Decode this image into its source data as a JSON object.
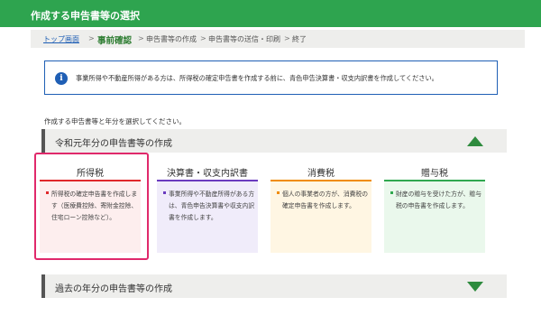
{
  "header": {
    "title": "作成する申告書等の選択"
  },
  "steps": {
    "top": "トップ画面",
    "current": "事前確認",
    "step3": "申告書等の作成",
    "step4": "申告書等の送信・印刷",
    "step5": "終了",
    "separator": ">"
  },
  "notice": {
    "icon": "i",
    "text": "事業所得や不動産所得がある方は、所得税の確定申告書を作成する前に、青色申告決算書・収支内訳書を作成してください。"
  },
  "instruction": "作成する申告書等と年分を選択してください。",
  "section_current": {
    "label": "令和元年分の申告書等の作成",
    "icon": "triangle-up"
  },
  "section_past": {
    "label": "過去の年分の申告書等の作成",
    "icon": "triangle-down"
  },
  "cards": [
    {
      "name": "所得税",
      "desc": "所得税の確定申告書を作成します（医療費控除、寄附金控除、住宅ローン控除など）。",
      "accent": "#e0282b",
      "bg": "#fdeeee"
    },
    {
      "name": "決算書・収支内訳書",
      "desc": "事業所得や不動産所得がある方は、青色申告決算書や収支内訳書を作成します。",
      "accent": "#6a3bbf",
      "bg": "#f0ecfa"
    },
    {
      "name": "消費税",
      "desc": "個人の事業者の方が、消費税の確定申告書を作成します。",
      "accent": "#f08c00",
      "bg": "#fff6e3"
    },
    {
      "name": "贈与税",
      "desc": "財産の贈与を受けた方が、贈与税の申告書を作成します。",
      "accent": "#2fa84f",
      "bg": "#eaf8ec"
    }
  ],
  "colors": {
    "brand": "#2ea44f",
    "link": "#1f5fb5",
    "highlight": "#e0296b"
  }
}
